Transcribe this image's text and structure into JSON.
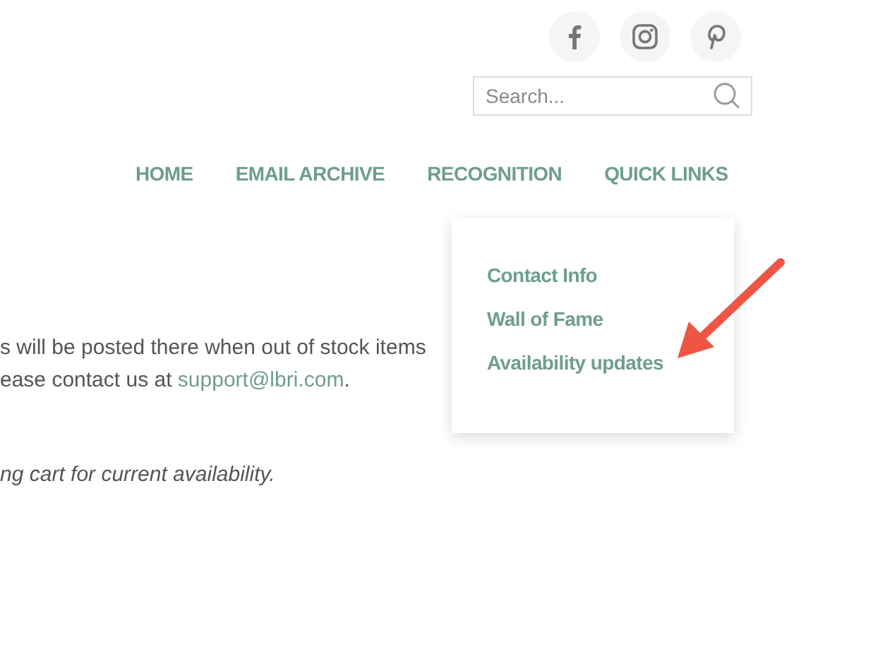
{
  "social": [
    {
      "kind": "facebook"
    },
    {
      "kind": "instagram"
    },
    {
      "kind": "pinterest"
    }
  ],
  "search": {
    "placeholder": "Search..."
  },
  "nav": {
    "items": [
      "HOME",
      "EMAIL ARCHIVE",
      "RECOGNITION",
      "QUICK LINKS"
    ]
  },
  "dropdown": {
    "items": [
      "Contact Info",
      "Wall of Fame",
      "Availability updates"
    ]
  },
  "content": {
    "line_1": "s will be posted there when out of stock items",
    "line_2": "ease contact us at ",
    "link": "support@lbri.com",
    "line_2_end": ".",
    "note": "ng cart for current availability."
  }
}
